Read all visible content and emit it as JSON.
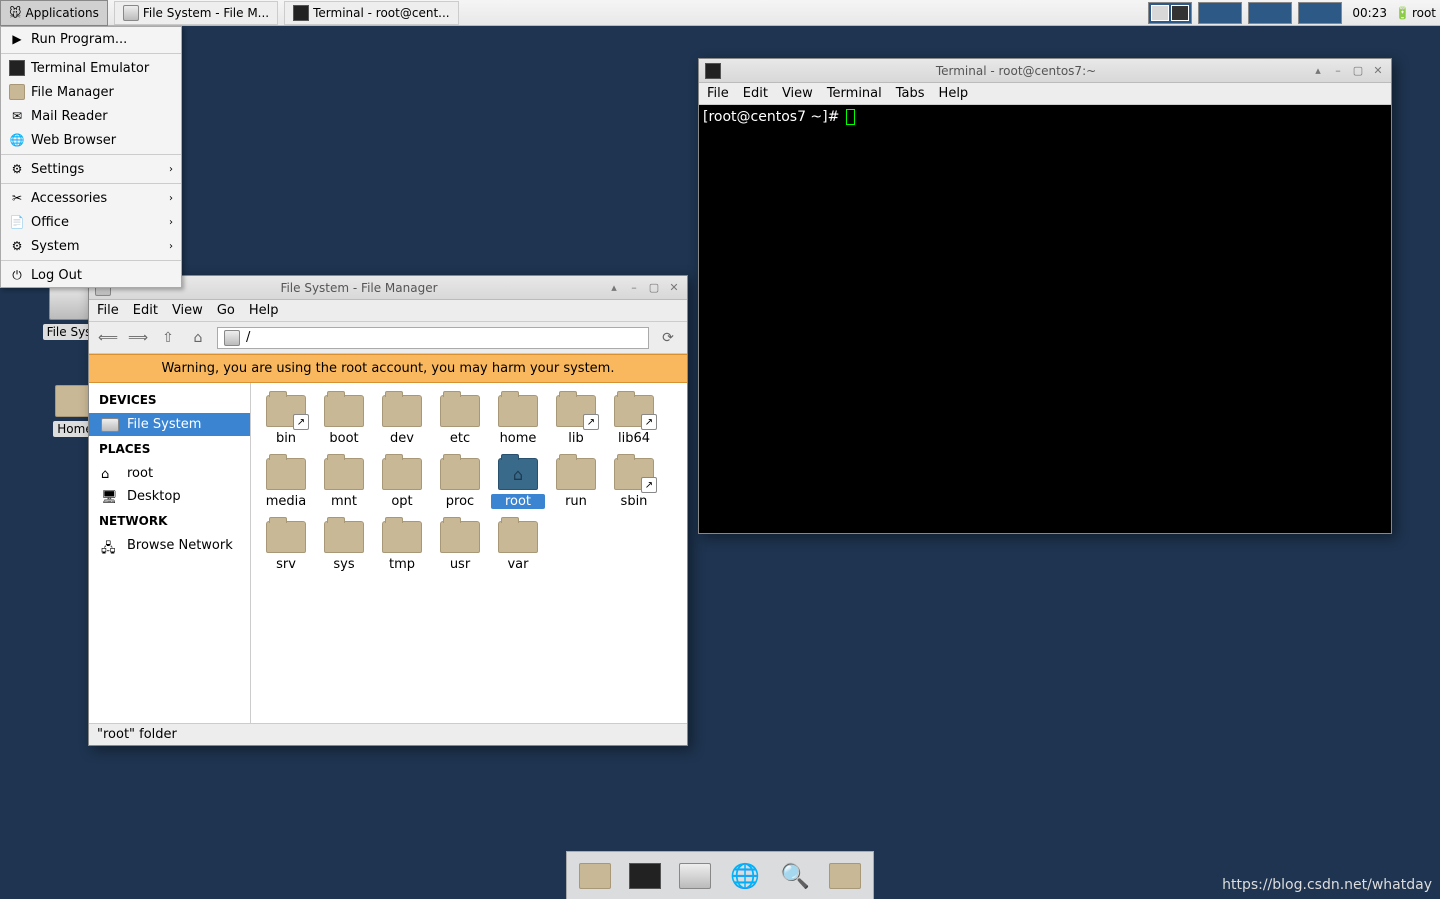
{
  "panel": {
    "apps_button": "Applications",
    "task1": "File System - File M...",
    "task2": "Terminal - root@cent...",
    "clock": "00:23",
    "user": "root"
  },
  "app_menu": {
    "run": "Run Program...",
    "terminal": "Terminal Emulator",
    "filemgr": "File Manager",
    "mail": "Mail Reader",
    "web": "Web Browser",
    "settings": "Settings",
    "accessories": "Accessories",
    "office": "Office",
    "system": "System",
    "logout": "Log Out"
  },
  "desktop": {
    "filesystem": "File Sys",
    "home": "Home"
  },
  "fm": {
    "title": "File System - File Manager",
    "menus": [
      "File",
      "Edit",
      "View",
      "Go",
      "Help"
    ],
    "path": "/",
    "warning": "Warning, you are using the root account, you may harm your system.",
    "sidebar": {
      "devices": "DEVICES",
      "filesystem": "File System",
      "places": "PLACES",
      "root": "root",
      "desktop": "Desktop",
      "network": "NETWORK",
      "browse": "Browse Network"
    },
    "folders": [
      {
        "n": "bin",
        "link": true
      },
      {
        "n": "boot"
      },
      {
        "n": "dev"
      },
      {
        "n": "etc"
      },
      {
        "n": "home"
      },
      {
        "n": "lib",
        "link": true
      },
      {
        "n": "lib64",
        "link": true
      },
      {
        "n": "media"
      },
      {
        "n": "mnt"
      },
      {
        "n": "opt"
      },
      {
        "n": "proc"
      },
      {
        "n": "root",
        "home": true,
        "sel": true
      },
      {
        "n": "run"
      },
      {
        "n": "sbin",
        "link": true
      },
      {
        "n": "srv"
      },
      {
        "n": "sys"
      },
      {
        "n": "tmp"
      },
      {
        "n": "usr"
      },
      {
        "n": "var"
      }
    ],
    "status": "\"root\" folder"
  },
  "terminal": {
    "title": "Terminal - root@centos7:~",
    "menus": [
      "File",
      "Edit",
      "View",
      "Terminal",
      "Tabs",
      "Help"
    ],
    "prompt": "[root@centos7 ~]# "
  },
  "watermark": "https://blog.csdn.net/whatday"
}
